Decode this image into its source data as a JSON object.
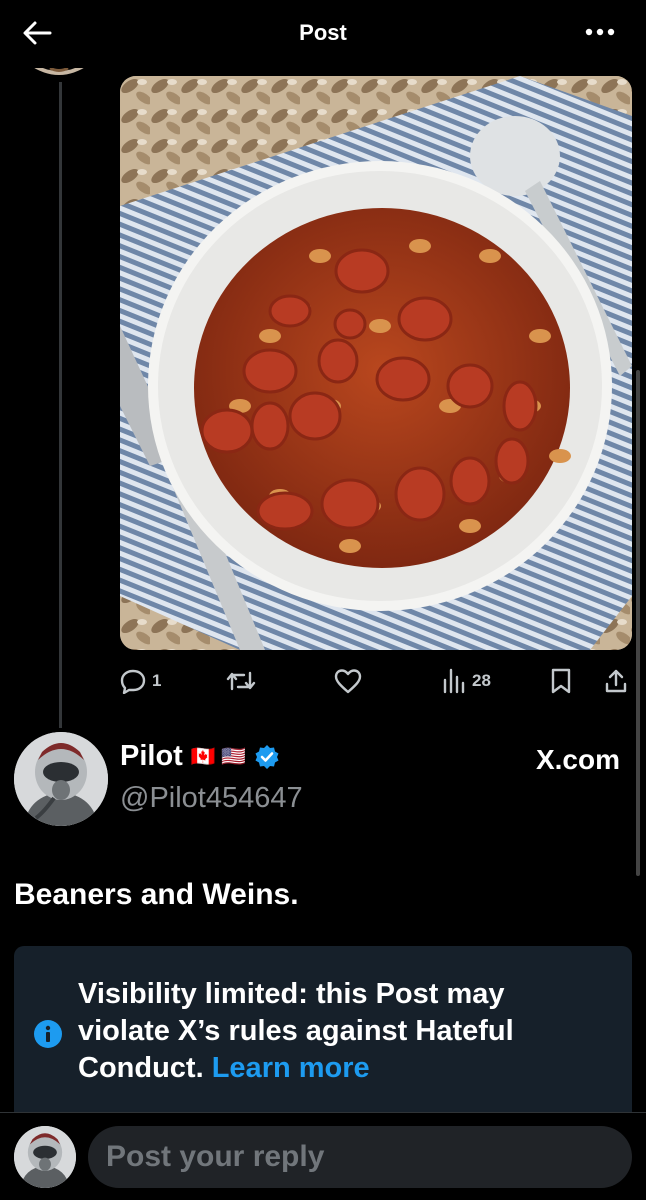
{
  "header": {
    "title": "Post"
  },
  "post": {
    "image_alt": "Bowl of beans with sliced hot dogs",
    "stats": {
      "replies": "1",
      "views": "28"
    },
    "author": {
      "name": "Pilot",
      "flags": "🇨🇦 🇺🇸",
      "handle": "@Pilot454647",
      "source": "X.com"
    },
    "text": "Beaners and Weins.",
    "notice": {
      "message": "Visibility limited: this Post may violate X’s rules against Hateful Conduct.",
      "link": "Learn more"
    }
  },
  "reply": {
    "placeholder": "Post your reply"
  },
  "colors": {
    "background": "#000000",
    "accent": "#1d9bf0",
    "notice_bg": "#16202a"
  },
  "icons": [
    "arrow-left-icon",
    "more-icon",
    "reply-icon",
    "retweet-icon",
    "like-icon",
    "views-icon",
    "bookmark-icon",
    "share-icon",
    "verified-icon",
    "info-icon"
  ]
}
